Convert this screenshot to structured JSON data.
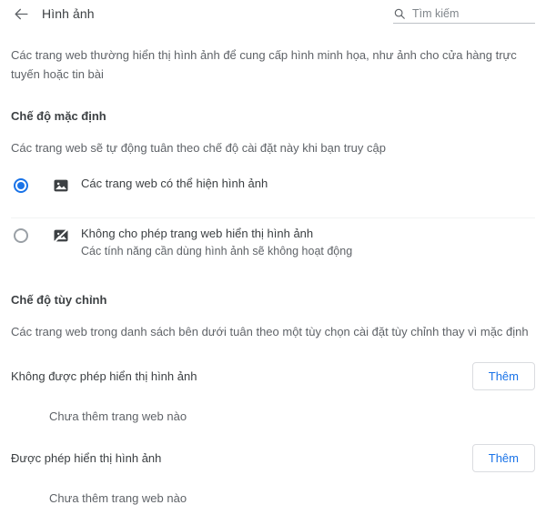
{
  "header": {
    "back_icon": "arrow-left-icon",
    "title": "Hình ảnh",
    "search": {
      "icon": "search-icon",
      "placeholder": "Tìm kiếm",
      "value": ""
    }
  },
  "intro": "Các trang web thường hiển thị hình ảnh để cung cấp hình minh họa, như ảnh cho cửa hàng trực tuyến hoặc tin bài",
  "default_mode": {
    "title": "Chế độ mặc định",
    "description": "Các trang web sẽ tự động tuân theo chế độ cài đặt này khi bạn truy cập",
    "options": [
      {
        "icon": "image-icon",
        "label": "Các trang web có thể hiện hình ảnh",
        "sublabel": "",
        "selected": true
      },
      {
        "icon": "image-off-icon",
        "label": "Không cho phép trang web hiển thị hình ảnh",
        "sublabel": "Các tính năng cần dùng hình ảnh sẽ không hoạt động",
        "selected": false
      }
    ]
  },
  "custom_mode": {
    "title": "Chế độ tùy chỉnh",
    "description": "Các trang web trong danh sách bên dưới tuân theo một tùy chọn cài đặt tùy chỉnh thay vì mặc định",
    "lists": [
      {
        "label": "Không được phép hiển thị hình ảnh",
        "add_label": "Thêm",
        "empty_text": "Chưa thêm trang web nào"
      },
      {
        "label": "Được phép hiển thị hình ảnh",
        "add_label": "Thêm",
        "empty_text": "Chưa thêm trang web nào"
      }
    ]
  },
  "colors": {
    "accent": "#1a73e8",
    "text_primary": "#3c4043",
    "text_secondary": "#5f6368",
    "radio_unselected": "#9aa0a6",
    "divider": "#f1f3f4",
    "border": "#dadce0"
  }
}
